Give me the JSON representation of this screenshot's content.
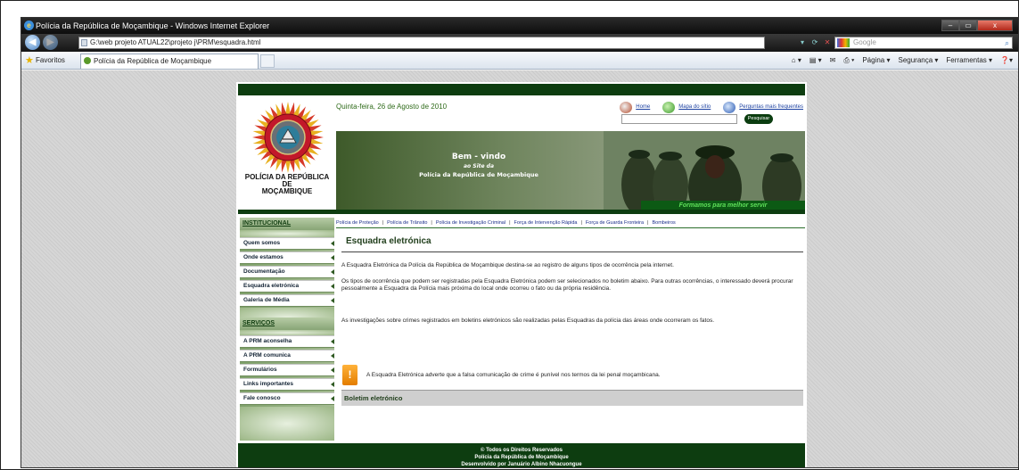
{
  "window": {
    "title": "Polícia da República de Moçambique - Windows Internet Explorer",
    "buttons": [
      "–",
      "▭",
      "x"
    ]
  },
  "addressbar": {
    "url": "G:\\web projeto ATUAL22\\projeto j\\PRM\\esquadra.html",
    "search_placeholder": "Google"
  },
  "favbar": {
    "favorites_label": "Favoritos",
    "tab_title": "Polícia da República de Moçambique",
    "commands": [
      "Página ▾",
      "Segurança ▾",
      "Ferramentas ▾"
    ]
  },
  "site": {
    "logo_title_line1": "POLÍCIA DA REPÚBLICA",
    "logo_title_line2": "DE",
    "logo_title_line3": "MOÇAMBIQUE",
    "date": "Quinta-feira, 26 de Agosto de 2010",
    "toplinks": {
      "home": "Home",
      "sitemap": "Mapa do sítio",
      "faq": "Perguntas mais frequentes"
    },
    "search_button": "Pesquisar",
    "banner": {
      "greeting": "Bem - vindo",
      "line2": "ao Site da",
      "line3": "Polícia da República de Moçambique",
      "slogan": "Formamos para melhor servir"
    },
    "nav_links": [
      "Polícia de Proteção",
      "Polícia de Trânsito",
      "Polícia de Investigação Criminal",
      "Força de Intervenção Rápida",
      "Força de Guarda Fronteira",
      "Bombeiros"
    ],
    "sidebar": {
      "institucional_heading": "INSTITUCIONAL",
      "institucional_items": [
        "Quem somos",
        "Onde estamos",
        "Documentação",
        "Esquadra eletrónica",
        "Galeria de Média"
      ],
      "servicos_heading": "SERVIÇOS",
      "servicos_items": [
        "A PRM aconselha",
        "A PRM comunica",
        "Formulários",
        "Links importantes",
        "Fale conosco"
      ]
    },
    "main": {
      "title": "Esquadra eletrónica",
      "para1": "A Esquadra Eletrónica da Polícia da República de Moçambique destina-se ao registro de alguns tipos de ocorrência pela internet.",
      "para2": "Os tipos de ocorrência que podem ser registradas pela Esquadra Eletrónica podem ser selecionados no boletim abaixo. Para outras ocorrências, o interessado deverá procurar pessoalmente a Esquadra da Polícia mais próxima do local onde ocorreu o fato ou da própria residência.",
      "para3": "As investigações sobre crimes registrados em boletins eletrónicos são realizadas pelas Esquadras da polícia das áreas onde ocorreram os fatos.",
      "warning_icon": "!",
      "warning": "A Esquadra Eletrónica adverte que a falsa comunicação de crime é punível nos termos da lei penal moçambicana.",
      "boletim": "Boletim eletrónico"
    },
    "footer": {
      "line1": "© Todos os Direitos Reservados",
      "line2": "Polícia da República de Moçambique",
      "line3": "Desenvolvido por Januário Albino Nhacuongue"
    }
  },
  "colors": {
    "dark_green": "#0d3d10",
    "link_blue": "#1a3fa0",
    "warning_orange": "#f39a1e",
    "sidebar_green": "#8fab7c"
  }
}
